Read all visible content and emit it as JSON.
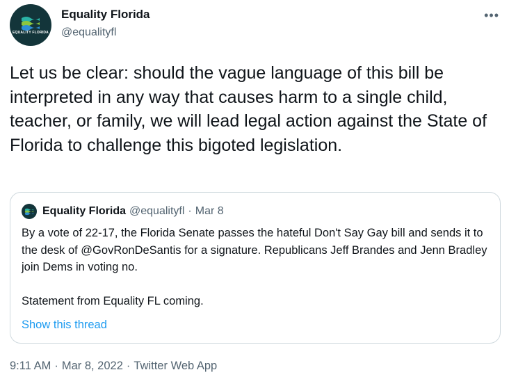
{
  "tweet": {
    "author_name": "Equality Florida",
    "author_handle": "@equalityfl",
    "avatar_text": "EQUALITY FLORIDA",
    "more_icon": "•••",
    "text": "Let us be clear: should the vague language of this bill be interpreted in any way that causes harm to a single child, teacher, or family, we will lead legal action against the State of Florida to challenge this bigoted legislation.",
    "time": "9:11 AM",
    "date": "Mar 8, 2022",
    "source": "Twitter Web App",
    "separator": "·"
  },
  "quote": {
    "author_name": "Equality Florida",
    "author_handle": "@equalityfl",
    "separator": "·",
    "date": "Mar 8",
    "text_paragraph_1": "By a vote of 22-17, the Florida Senate passes the hateful Don't Say Gay bill and sends it to the desk of @GovRonDeSantis for a signature. Republicans Jeff Brandes and Jenn Bradley join Dems in voting no.",
    "text_paragraph_2": "Statement from Equality FL coming.",
    "show_thread": "Show this thread"
  },
  "colors": {
    "text_primary": "#0f1419",
    "text_secondary": "#536471",
    "link": "#1d9bf0",
    "border": "#cfd9de",
    "avatar_bg": "#13353a",
    "logo_teal": "#2bb3a6",
    "logo_green": "#8cc63f",
    "logo_blue": "#2d8fd5"
  }
}
